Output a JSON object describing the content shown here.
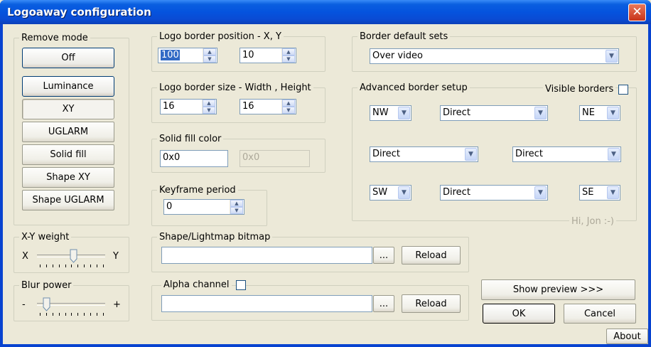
{
  "window": {
    "title": "Logoaway configuration",
    "close_glyph": "✕"
  },
  "remove_mode": {
    "label": "Remove mode",
    "buttons": [
      "Off",
      "Luminance",
      "XY",
      "UGLARM",
      "Solid fill",
      "Shape XY",
      "Shape UGLARM"
    ],
    "selected": "XY"
  },
  "xy_weight": {
    "label": "X-Y weight",
    "left": "X",
    "right": "Y",
    "value_fraction": 0.5
  },
  "blur_power": {
    "label": "Blur power",
    "left": "-",
    "right": "+",
    "value_fraction": 0.1
  },
  "logo_position": {
    "label": "Logo border position - X, Y",
    "x": "100",
    "y": "10"
  },
  "logo_size": {
    "label": "Logo border size - Width , Height",
    "width": "16",
    "height": "16"
  },
  "solid_fill": {
    "label": "Solid fill color",
    "value": "0x0",
    "value_disabled": "0x0"
  },
  "keyframe": {
    "label": "Keyframe period",
    "value": "0"
  },
  "shape_bitmap": {
    "label": "Shape/Lightmap bitmap",
    "value": "",
    "browse": "...",
    "reload": "Reload"
  },
  "alpha_channel": {
    "label": "Alpha channel",
    "checked": false,
    "value": "",
    "browse": "...",
    "reload": "Reload"
  },
  "border_default_sets": {
    "label": "Border default sets",
    "selected": "Over video"
  },
  "advanced_border": {
    "label": "Advanced border setup",
    "visible_borders_label": "Visible borders",
    "visible_borders_checked": false,
    "nw": "NW",
    "top": "Direct",
    "ne": "NE",
    "left": "Direct",
    "right": "Direct",
    "sw": "SW",
    "bottom": "Direct",
    "se": "SE",
    "signature": "Hi, Jon :-)"
  },
  "actions": {
    "preview": "Show preview >>>",
    "ok": "OK",
    "cancel": "Cancel",
    "about": "About"
  },
  "colors": {
    "title_bar": "#0553de",
    "face": "#ece9d8",
    "close": "#c8341a",
    "selection": "#316ac5"
  }
}
